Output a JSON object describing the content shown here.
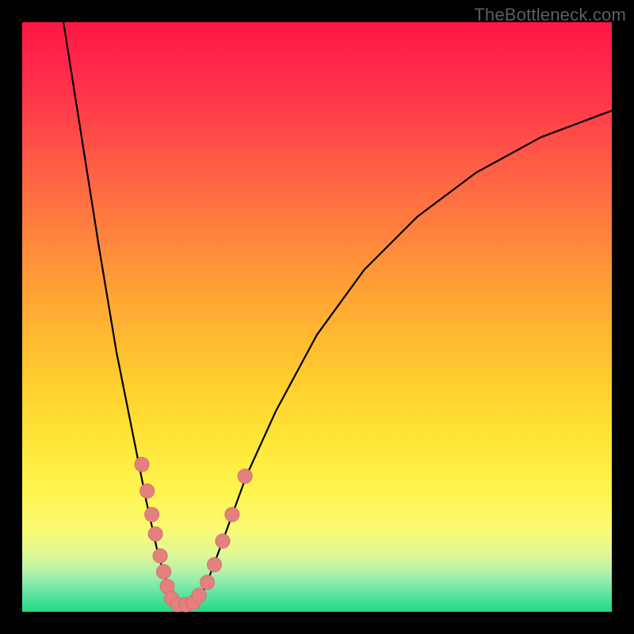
{
  "watermark": "TheBottleneck.com",
  "colors": {
    "background": "#000000",
    "curve": "#000000",
    "dot_fill": "#e58080",
    "dot_stroke": "#d66e6e"
  },
  "chart_data": {
    "type": "line",
    "title": "",
    "xlabel": "",
    "ylabel": "",
    "xlim": [
      0,
      100
    ],
    "ylim": [
      0,
      100
    ],
    "series": [
      {
        "name": "curve",
        "x": [
          7,
          10,
          13,
          16,
          19,
          21,
          23,
          24.5,
          26,
          27,
          28,
          29,
          31,
          34,
          38,
          43,
          50,
          58,
          67,
          77,
          88,
          100
        ],
        "y": [
          100,
          81,
          62,
          44,
          29,
          19,
          10,
          5,
          2,
          1.2,
          1.2,
          1.5,
          4,
          12,
          23,
          34,
          47,
          58,
          67,
          74.5,
          80.5,
          85
        ]
      }
    ],
    "dots": {
      "x": [
        20.3,
        21.2,
        22.0,
        22.6,
        23.4,
        24.0,
        24.6,
        25.3,
        26.4,
        27.8,
        29.0,
        30.0,
        31.4,
        32.6,
        34.0,
        35.6,
        37.8
      ],
      "y": [
        25.0,
        20.5,
        16.5,
        13.2,
        9.5,
        6.8,
        4.3,
        2.3,
        1.2,
        1.2,
        1.6,
        2.8,
        5.0,
        8.0,
        12.0,
        16.5,
        23.0
      ]
    }
  }
}
